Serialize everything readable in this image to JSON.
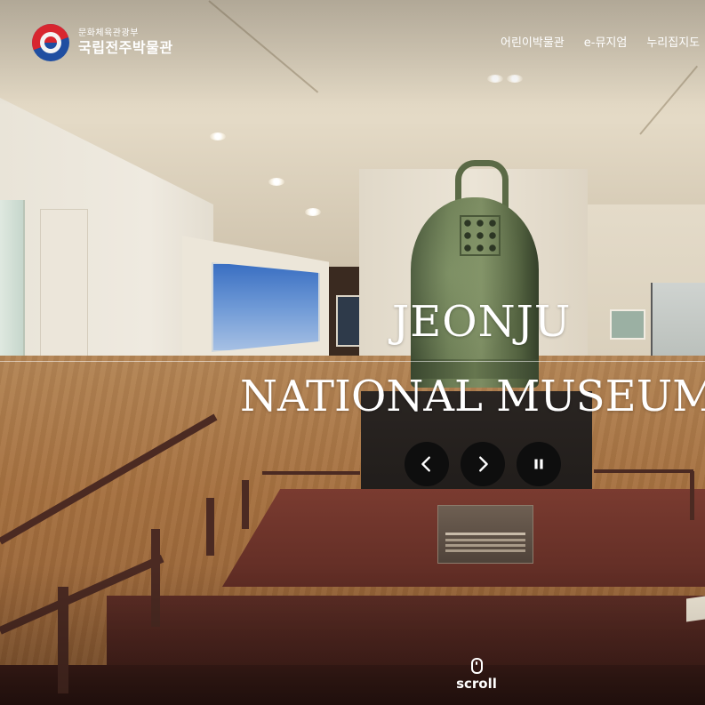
{
  "header": {
    "ministry": "문화체육관광부",
    "museum_name": "국립전주박물관",
    "nav": [
      {
        "label": "어린이박물관"
      },
      {
        "label": "e-뮤지엄"
      },
      {
        "label": "누리집지도"
      }
    ]
  },
  "hero": {
    "title_line1": "JEONJU",
    "title_line2": "NATIONAL MUSEUM"
  },
  "slider": {
    "prev_icon": "chevron-left-icon",
    "next_icon": "chevron-right-icon",
    "pause_icon": "pause-icon"
  },
  "scroll": {
    "label": "scroll",
    "icon": "mouse-icon"
  },
  "colors": {
    "control_bg": "#0e0e0e",
    "text": "#ffffff"
  }
}
